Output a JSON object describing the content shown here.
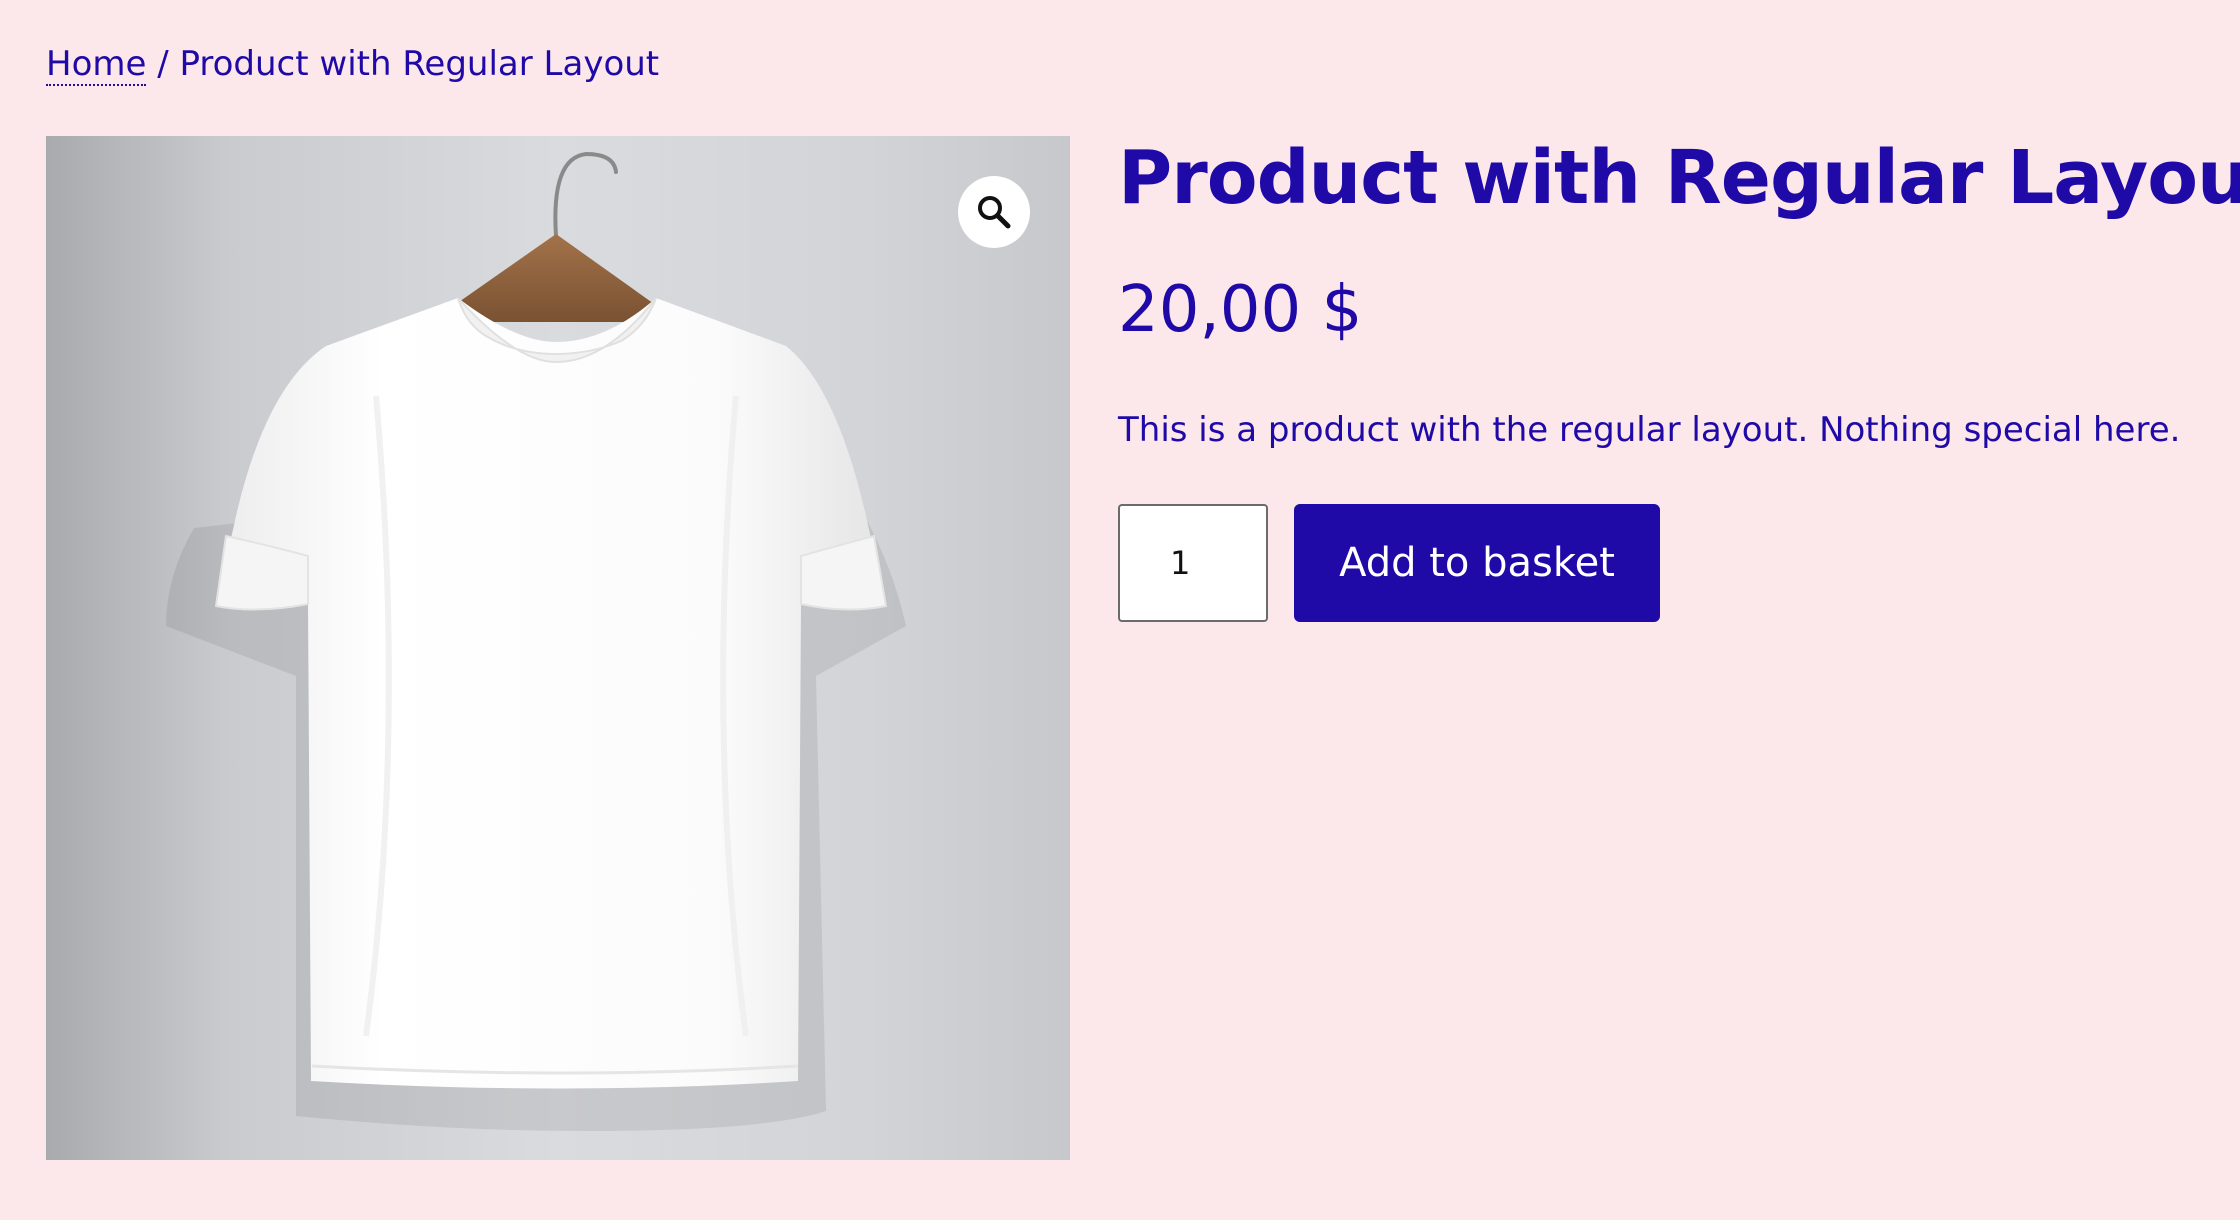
{
  "breadcrumb": {
    "home_label": "Home",
    "separator": " / ",
    "current": "Product with Regular Layout"
  },
  "product": {
    "image_subject": "white-tshirt-on-hanger",
    "zoom_icon": "magnifier-icon",
    "title": "Product with Regular Layout",
    "price": "20,00 $",
    "description": "This is a product with the regular layout. Nothing special here.",
    "quantity": "1",
    "add_to_basket_label": "Add to basket"
  },
  "colors": {
    "background": "#fce8ea",
    "accent": "#1f0aa8",
    "button_text": "#ffffff"
  }
}
